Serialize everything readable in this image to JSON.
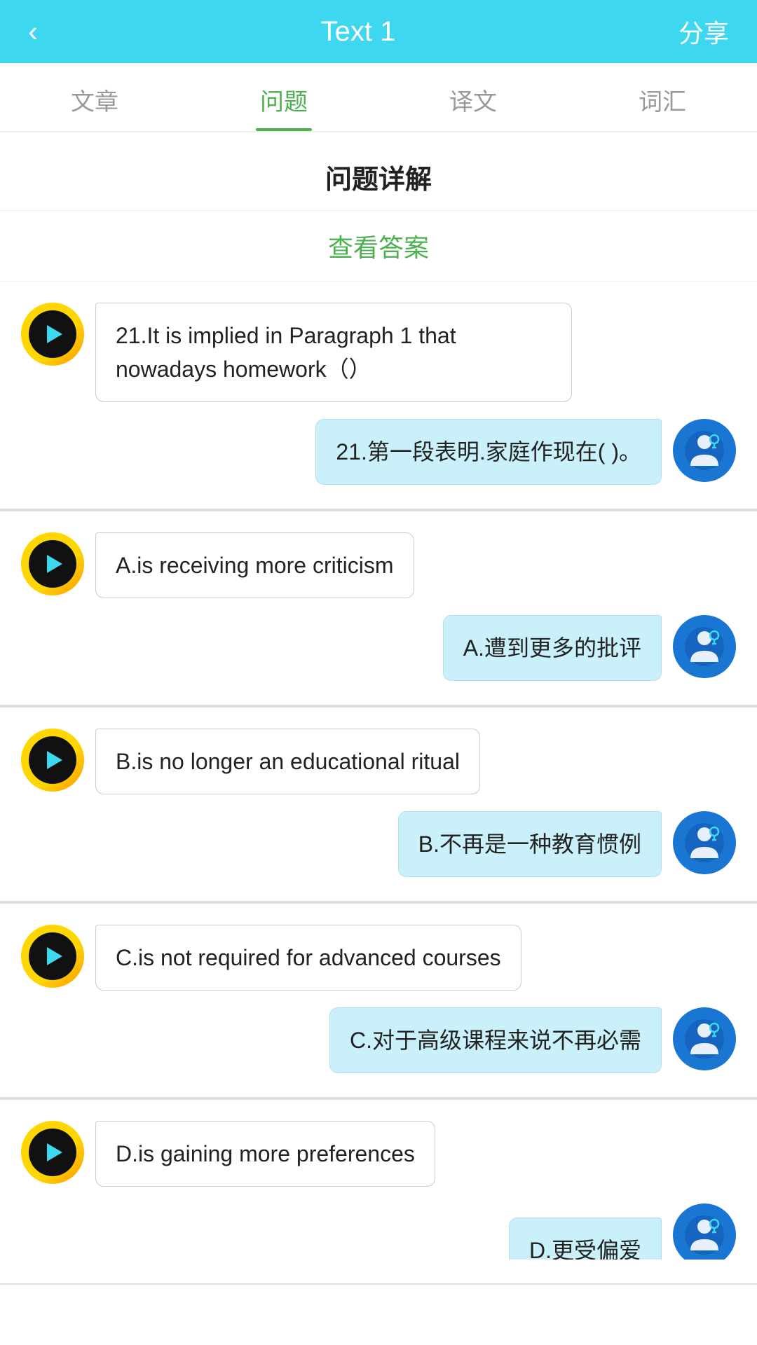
{
  "header": {
    "back_label": "‹",
    "title": "Text 1",
    "share_label": "分享"
  },
  "tabs": [
    {
      "id": "article",
      "label": "文章",
      "active": false
    },
    {
      "id": "questions",
      "label": "问题",
      "active": true
    },
    {
      "id": "translation",
      "label": "译文",
      "active": false
    },
    {
      "id": "vocabulary",
      "label": "词汇",
      "active": false
    }
  ],
  "page_title": "问题详解",
  "view_answer_label": "查看答案",
  "chat_items": [
    {
      "id": "q21-en",
      "side": "left",
      "text": "21.It is implied in Paragraph 1 that nowadays homework（）"
    },
    {
      "id": "q21-zh",
      "side": "right",
      "text": "21.第一段表明.家庭作现在( )。"
    },
    {
      "id": "optA-en",
      "side": "left",
      "text": "A.is receiving more criticism"
    },
    {
      "id": "optA-zh",
      "side": "right",
      "text": "A.遭到更多的批评"
    },
    {
      "id": "optB-en",
      "side": "left",
      "text": "B.is no longer an educational ritual"
    },
    {
      "id": "optB-zh",
      "side": "right",
      "text": "B.不再是一种教育惯例"
    },
    {
      "id": "optC-en",
      "side": "left",
      "text": "C.is not required for advanced courses"
    },
    {
      "id": "optC-zh",
      "side": "right",
      "text": "C.对于高级课程来说不再必需"
    },
    {
      "id": "optD-en",
      "side": "left",
      "text": "D.is gaining more preferences"
    },
    {
      "id": "optD-zh",
      "side": "right",
      "text": "D.更受偏爱"
    }
  ],
  "colors": {
    "header_bg": "#3DD8F0",
    "active_tab": "#4CAF50",
    "answer_btn": "#4CAF50",
    "bubble_right_bg": "#CAF0FA",
    "bot_outer": "#FFD600",
    "bot_inner": "#111111",
    "bot_play": "#3DD8F0",
    "user_bg": "#1976D2"
  }
}
